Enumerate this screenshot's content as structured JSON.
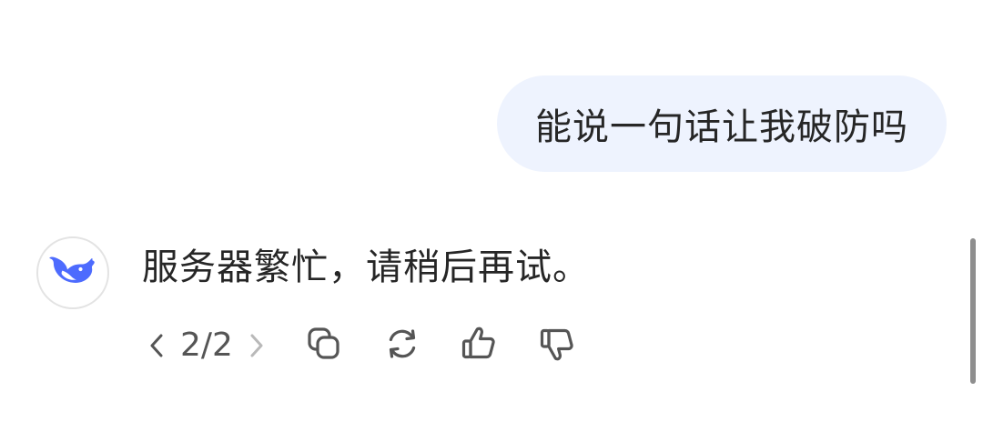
{
  "conversation": {
    "user_message": "能说一句话让我破防吗",
    "assistant_message": "服务器繁忙，请稍后再试。"
  },
  "assistant": {
    "avatar_icon": "whale-icon",
    "brand_color": "#4d6bfe"
  },
  "actions": {
    "pager_text": "2/2",
    "prev_icon": "chevron-left-icon",
    "next_icon": "chevron-right-icon",
    "copy_icon": "copy-icon",
    "regenerate_icon": "refresh-icon",
    "like_icon": "thumbs-up-icon",
    "dislike_icon": "thumbs-down-icon"
  },
  "colors": {
    "user_bubble": "#eef3fe",
    "text": "#262626",
    "icon": "#555555",
    "disabled_icon": "#b9b9b9"
  }
}
